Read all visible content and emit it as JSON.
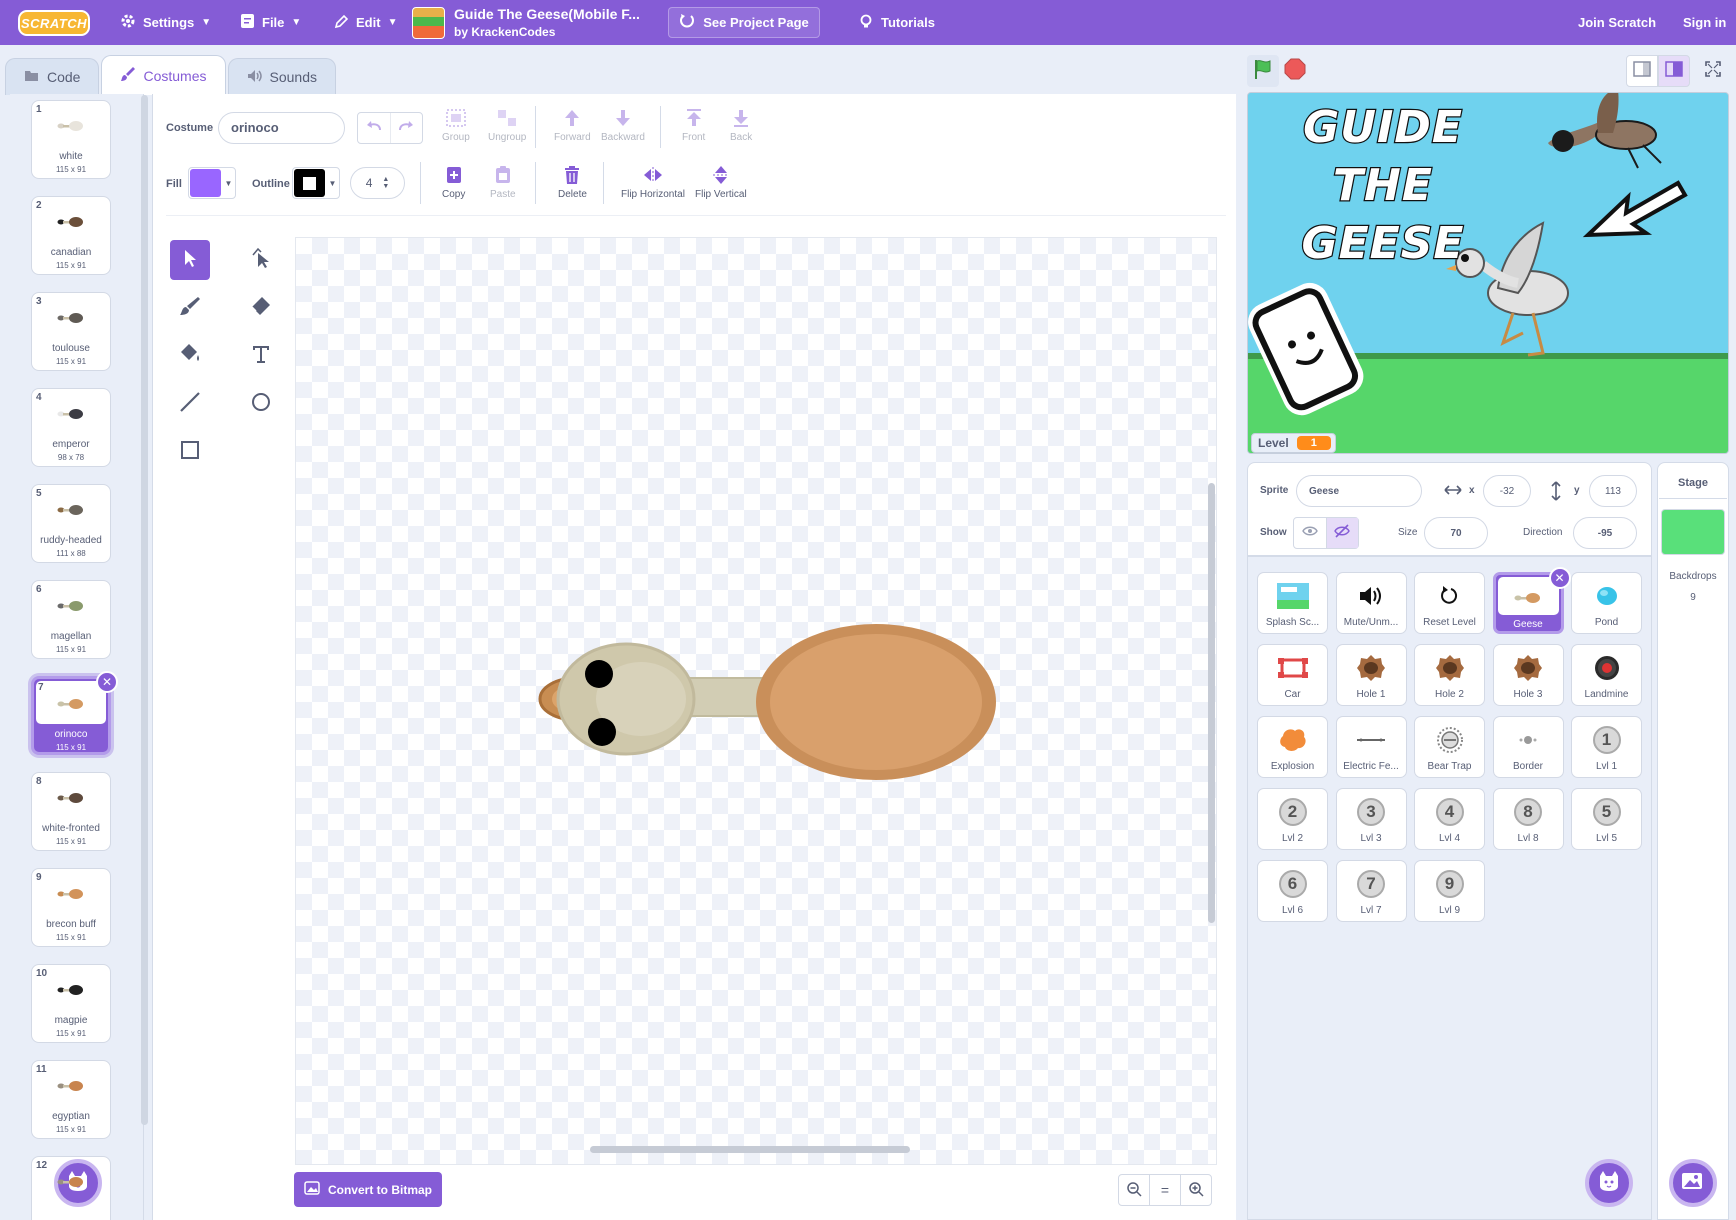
{
  "menubar": {
    "logo": "SCRATCH",
    "settings": "Settings",
    "file": "File",
    "edit": "Edit",
    "project_title": "Guide The Geese(Mobile F...",
    "project_author": "by KrackenCodes",
    "see_project_page": "See Project Page",
    "tutorials": "Tutorials",
    "join": "Join Scratch",
    "signin": "Sign in"
  },
  "tabs": [
    "Code",
    "Costumes",
    "Sounds"
  ],
  "costumes": [
    {
      "num": "1",
      "name": "white",
      "size": "115 x 91",
      "body": "#e8e4dc",
      "head": "#d8d2c6"
    },
    {
      "num": "2",
      "name": "canadian",
      "size": "115 x 91",
      "body": "#6b4f3a",
      "head": "#222"
    },
    {
      "num": "3",
      "name": "toulouse",
      "size": "115 x 91",
      "body": "#5f5a54",
      "head": "#6d6a66"
    },
    {
      "num": "4",
      "name": "emperor",
      "size": "98 x 78",
      "body": "#3c3c44",
      "head": "#e8e8e8"
    },
    {
      "num": "5",
      "name": "ruddy-headed",
      "size": "111 x 88",
      "body": "#6b655c",
      "head": "#8a6a44"
    },
    {
      "num": "6",
      "name": "magellan",
      "size": "115 x 91",
      "body": "#8a9a6c",
      "head": "#6a6a6a"
    },
    {
      "num": "7",
      "name": "orinoco",
      "size": "115 x 91",
      "body": "#d49a62",
      "head": "#c9c3a8"
    },
    {
      "num": "8",
      "name": "white-fronted",
      "size": "115 x 91",
      "body": "#5e4a3c",
      "head": "#6b5a4a"
    },
    {
      "num": "9",
      "name": "brecon buff",
      "size": "115 x 91",
      "body": "#d2935a",
      "head": "#c88c52"
    },
    {
      "num": "10",
      "name": "magpie",
      "size": "115 x 91",
      "body": "#222",
      "head": "#222"
    },
    {
      "num": "11",
      "name": "egyptian",
      "size": "115 x 91",
      "body": "#c8844e",
      "head": "#9a9080"
    },
    {
      "num": "12",
      "name": "",
      "size": "",
      "body": "#c8844e",
      "head": "#9a9080"
    }
  ],
  "editor": {
    "costume_label": "Costume",
    "costume_name": "orinoco",
    "fill_label": "Fill",
    "outline_label": "Outline",
    "outline_width": "4",
    "fill_color": "#9966ff",
    "buttons": {
      "group": "Group",
      "ungroup": "Ungroup",
      "forward": "Forward",
      "backward": "Backward",
      "front": "Front",
      "back": "Back",
      "copy": "Copy",
      "paste": "Paste",
      "delete": "Delete",
      "flip_h": "Flip Horizontal",
      "flip_v": "Flip Vertical"
    },
    "convert": "Convert to Bitmap",
    "zoom_reset": "="
  },
  "stage": {
    "title_lines": [
      "GUIDE",
      "THE",
      "GEESE"
    ],
    "monitor_label": "Level",
    "monitor_value": "1"
  },
  "sprite_info": {
    "sprite_label": "Sprite",
    "sprite_name": "Geese",
    "x_label": "x",
    "x": "-32",
    "y_label": "y",
    "y": "113",
    "show_label": "Show",
    "size_label": "Size",
    "size": "70",
    "direction_label": "Direction",
    "direction": "-95"
  },
  "sprites": [
    {
      "name": "Splash Sc...",
      "icon": "splash"
    },
    {
      "name": "Mute/Unm...",
      "icon": "speaker"
    },
    {
      "name": "Reset Level",
      "icon": "reset"
    },
    {
      "name": "Geese",
      "icon": "goose",
      "selected": true
    },
    {
      "name": "Pond",
      "icon": "pond"
    },
    {
      "name": "Car",
      "icon": "car"
    },
    {
      "name": "Hole 1",
      "icon": "hole"
    },
    {
      "name": "Hole 2",
      "icon": "hole"
    },
    {
      "name": "Hole 3",
      "icon": "hole"
    },
    {
      "name": "Landmine",
      "icon": "landmine"
    },
    {
      "name": "Explosion",
      "icon": "explosion"
    },
    {
      "name": "Electric Fe...",
      "icon": "fence"
    },
    {
      "name": "Bear Trap",
      "icon": "beartrap"
    },
    {
      "name": "Border",
      "icon": "border"
    },
    {
      "name": "Lvl 1",
      "icon": "num",
      "n": "1"
    },
    {
      "name": "Lvl 2",
      "icon": "num",
      "n": "2"
    },
    {
      "name": "Lvl 3",
      "icon": "num",
      "n": "3"
    },
    {
      "name": "Lvl 4",
      "icon": "num",
      "n": "4"
    },
    {
      "name": "Lvl 8",
      "icon": "num",
      "n": "8"
    },
    {
      "name": "Lvl 5",
      "icon": "num",
      "n": "5"
    },
    {
      "name": "Lvl 6",
      "icon": "num",
      "n": "6"
    },
    {
      "name": "Lvl 7",
      "icon": "num",
      "n": "7"
    },
    {
      "name": "Lvl 9",
      "icon": "num",
      "n": "9"
    }
  ],
  "stage_pane": {
    "title": "Stage",
    "backdrops_label": "Backdrops",
    "backdrops_count": "9",
    "thumb_color": "#59e07a"
  },
  "colors": {
    "accent": "#855cd6",
    "green_flag": "#4cbf56",
    "stop": "#ec5959"
  }
}
